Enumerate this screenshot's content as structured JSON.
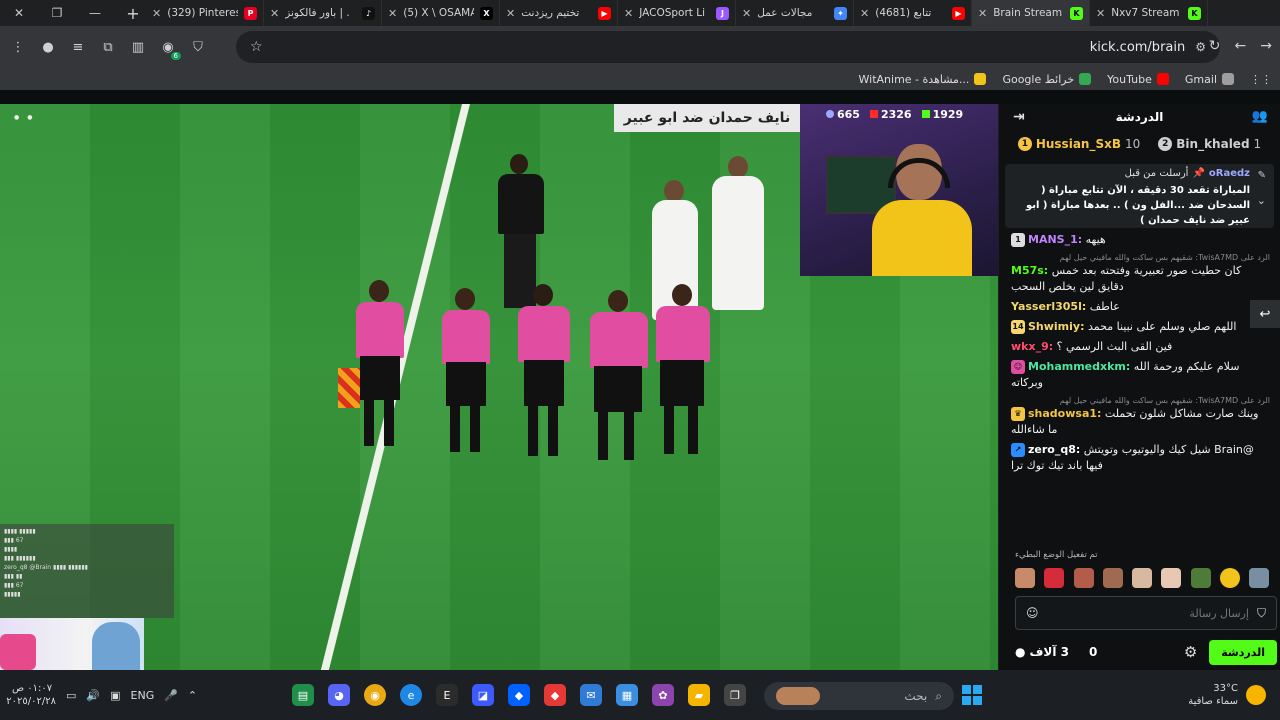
{
  "browser": {
    "tabs": [
      {
        "title": "(329) Pinterest",
        "fav_color": "#e60023",
        "fav_glyph": "P",
        "active": false
      },
      {
        "title": "باور فالكونز | .",
        "fav_color": "#111111",
        "fav_glyph": "♪",
        "active": false
      },
      {
        "title": "(5) X \\ OSAMA",
        "fav_color": "#000000",
        "fav_glyph": "X",
        "active": false
      },
      {
        "title": "تختيم ريزدنت",
        "fav_color": "#ff0000",
        "fav_glyph": "▶",
        "active": false
      },
      {
        "title": "JACOSport Li",
        "fav_color": "#9b59ff",
        "fav_glyph": "J",
        "active": false
      },
      {
        "title": "مجالات عمل",
        "fav_color": "#4285f4",
        "fav_glyph": "✦",
        "active": false
      },
      {
        "title": "(4681) تتابع",
        "fav_color": "#ff0000",
        "fav_glyph": "▶",
        "active": false
      },
      {
        "title": "Brain Stream",
        "fav_color": "#53fc18",
        "fav_glyph": "K",
        "active": true
      },
      {
        "title": "Nxv7 Stream",
        "fav_color": "#53fc18",
        "fav_glyph": "K",
        "active": false
      }
    ],
    "url": "kick.com/brain",
    "bookmarks": [
      {
        "label": "WitAnime - مشاهدة...",
        "color": "#f2c318"
      },
      {
        "label": "Google خرائط",
        "color": "#34a853"
      },
      {
        "label": "YouTube",
        "color": "#ff0000"
      },
      {
        "label": "Gmail",
        "color": "#9e9e9e"
      }
    ],
    "extensions_badge": "6"
  },
  "stream": {
    "overlay_title": "نايف حمدان ضد ابو عبير",
    "stats": {
      "viewers_a": "665",
      "viewers_b": "2326",
      "viewers_c": "1929"
    },
    "colors": {
      "pitch": "#3a9a3d",
      "ref_shirt": "#e14ea1",
      "accent": "#53fc18"
    }
  },
  "chat": {
    "title": "الدردشة",
    "leaders": [
      {
        "rank": "1",
        "name": "Hussian_SxB",
        "count": "10",
        "color": "#f5c542"
      },
      {
        "rank": "2",
        "name": "Bin_khaled",
        "count": "1",
        "color": "#cfcfcf"
      }
    ],
    "pinned": {
      "label": "أرسلت من قبل",
      "user": "oRaedz",
      "message": "المباراة تقعد 30 دقيقه ، الآن تتابع مباراة ( السدحان ضد ...الفل ون ) .. بعدها مباراة ( ابو عبير ضد نايف حمدان )"
    },
    "messages": [
      {
        "reply": "",
        "badge": "1",
        "badge_color": "#dddddd",
        "user": "MANS_1:",
        "user_color": "#c084fc",
        "text": "هيهه"
      },
      {
        "reply": "الرد على TwisA7MD: شقيهم بس ساكت والله مافيني حيل لهم",
        "badge": "",
        "badge_color": "",
        "user": "M57s:",
        "user_color": "#53fc18",
        "text": "كان حطيت صور تعبيرية وفتحته بعد خمس دقايق لين يخلص السحب"
      },
      {
        "reply": "",
        "badge": "",
        "badge_color": "",
        "user": "Yasserl305l:",
        "user_color": "#f5d76e",
        "text": "عاطف"
      },
      {
        "reply": "",
        "badge": "14",
        "badge_color": "#f5d76e",
        "user": "Shwimiy:",
        "user_color": "#f5d76e",
        "text": "اللهم صلي وسلم على نبينا محمد"
      },
      {
        "reply": "",
        "badge": "",
        "badge_color": "",
        "user": "wkx_9:",
        "user_color": "#ff4d6d",
        "text": "فين القى البث الرسمي ؟"
      },
      {
        "reply": "",
        "badge": "☺",
        "badge_color": "#e14ea1",
        "user": "Mohammedxkm:",
        "user_color": "#4ee6a3",
        "text": "سلام عليكم ورحمة الله وبركاته"
      },
      {
        "reply": "الرد على TwisA7MD: شقيهم بس ساكت والله مافيني حيل لهم",
        "badge": "♛",
        "badge_color": "#f5c542",
        "user": "shadowsa1:",
        "user_color": "#f5c542",
        "text": "وينك صارت مشاكل شلون تحملت ما شاءالله"
      },
      {
        "reply": "",
        "badge": "↗",
        "badge_color": "#2a8cff",
        "user": "zero_q8:",
        "user_color": "#ffffff",
        "text": "@Brain شيل كيك واليوتيوب وتويتش فيها باند تيك توك ترا"
      }
    ],
    "slow_mode": "تم تفعيل الوضع البطيء",
    "input_placeholder": "إرسال رسالة",
    "send_label": "الدردشة",
    "viewers_label": "3 آلاف",
    "points": "0"
  },
  "taskbar": {
    "clock_time": "٠١:٠٧ ص",
    "clock_date": "٢٠٢٥/٠٢/٢٨",
    "lang": "ENG",
    "search_label": "بحث",
    "weather_temp": "33°C",
    "weather_desc": "سماء صافية"
  }
}
